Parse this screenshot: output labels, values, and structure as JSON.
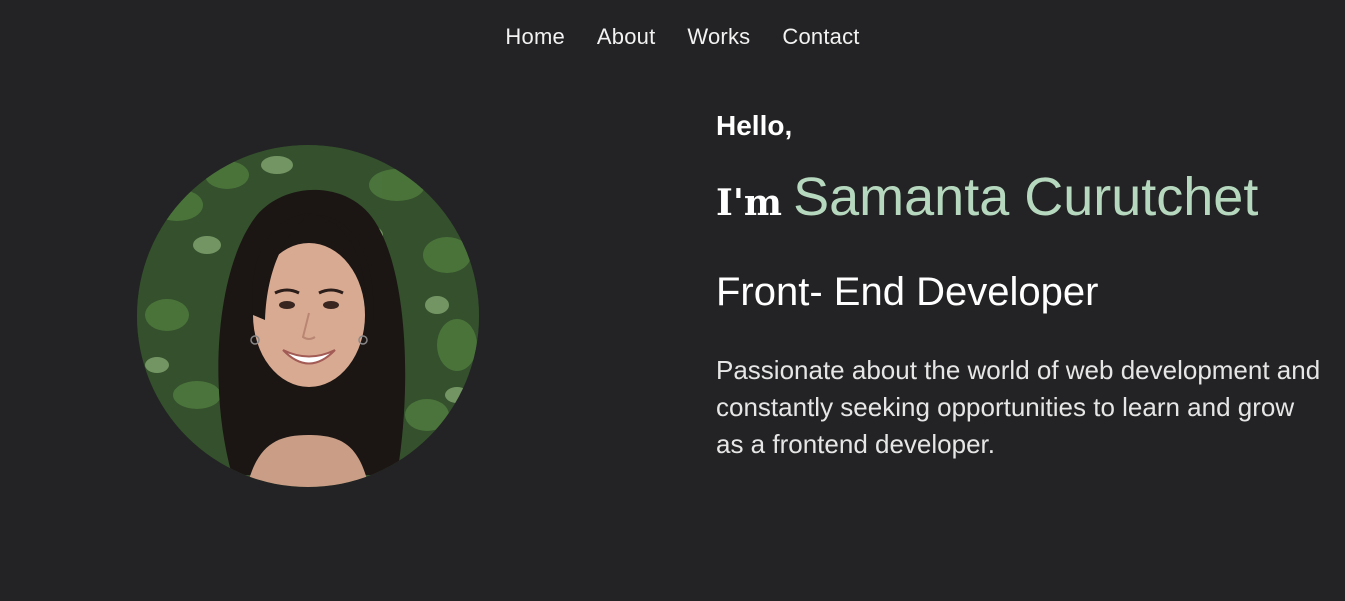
{
  "nav": {
    "items": [
      {
        "label": "Home"
      },
      {
        "label": "About"
      },
      {
        "label": "Works"
      },
      {
        "label": "Contact"
      }
    ]
  },
  "hero": {
    "greeting": "Hello,",
    "intro_prefix": "I'm",
    "name": "Samanta Curutchet",
    "role": "Front- End Developer",
    "bio": "Passionate about the world of web development and constantly seeking opportunities to learn and grow as a frontend developer.",
    "avatar_alt": "profile photo"
  },
  "colors": {
    "background": "#232325",
    "accent": "#b6d8be",
    "text": "#ffffff"
  }
}
